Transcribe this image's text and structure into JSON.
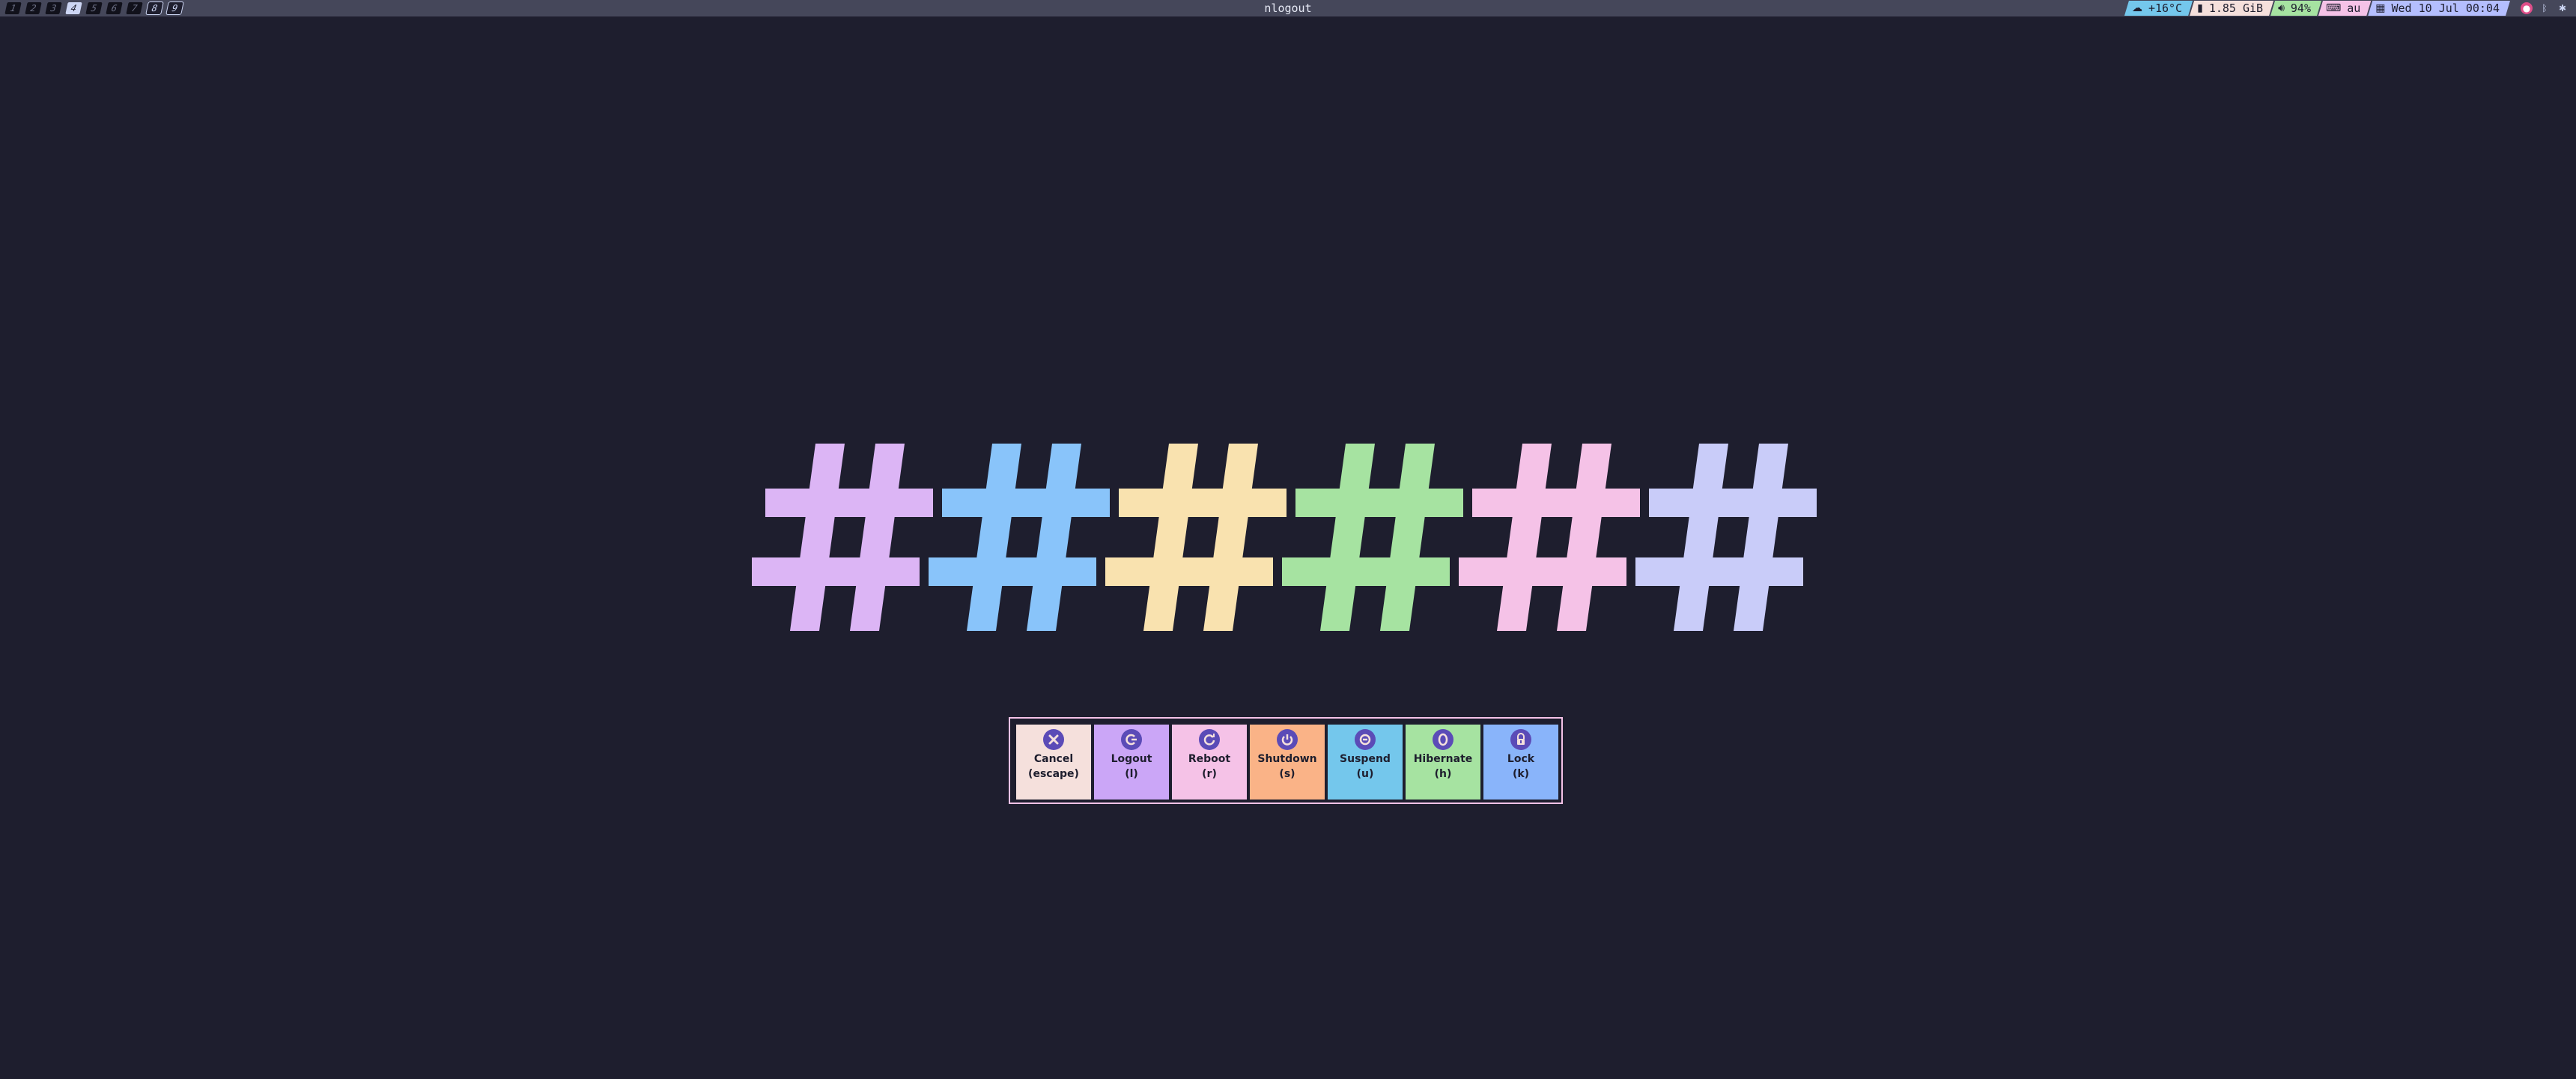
{
  "topbar": {
    "workspaces": [
      "1",
      "2",
      "3",
      "4",
      "5",
      "6",
      "7",
      "8",
      "9"
    ],
    "window_title": "nlogout",
    "status": {
      "weather": "+16°C",
      "memory": "1.85 GiB",
      "volume": "94%",
      "keyboard_layout": "au",
      "datetime": "Wed 10 Jul 00:04"
    },
    "colors": {
      "bar": "#45475a",
      "weather": "#74c7ec",
      "memory": "#f5e0dc",
      "volume": "#a6e3a1",
      "keyboard": "#f5c2e7",
      "datetime": "#b4befe"
    }
  },
  "logo": {
    "glyph": "#",
    "colors": [
      "#dcb5f5",
      "#89c4fa",
      "#f9e2af",
      "#a6e3a1",
      "#f5c2e7",
      "#c9ccf9"
    ]
  },
  "dialog": {
    "border_color": "#f5c2e7",
    "buttons": [
      {
        "label": "Cancel",
        "key": "(escape)",
        "color": "#f5e0dc",
        "icon": "close-icon"
      },
      {
        "label": "Logout",
        "key": "(l)",
        "color": "#cba6f7",
        "icon": "logout-icon"
      },
      {
        "label": "Reboot",
        "key": "(r)",
        "color": "#f5c2e7",
        "icon": "reboot-icon"
      },
      {
        "label": "Shutdown",
        "key": "(s)",
        "color": "#fab387",
        "icon": "power-icon"
      },
      {
        "label": "Suspend",
        "key": "(u)",
        "color": "#74c7ec",
        "icon": "suspend-icon"
      },
      {
        "label": "Hibernate",
        "key": "(h)",
        "color": "#a6e3a1",
        "icon": "hibernate-icon"
      },
      {
        "label": "Lock",
        "key": "(k)",
        "color": "#89b4fa",
        "icon": "lock-icon"
      }
    ]
  }
}
